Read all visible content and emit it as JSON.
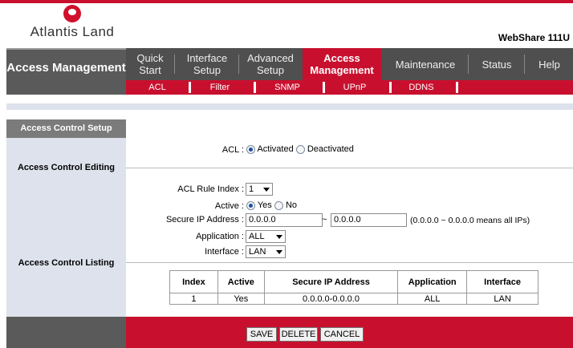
{
  "brand": {
    "logo_text": "Atlantis Land",
    "model": "WebShare 111U"
  },
  "section": {
    "title": "Access Management"
  },
  "nav": {
    "tabs": [
      {
        "label": "Quick Start"
      },
      {
        "label": "Interface Setup"
      },
      {
        "label": "Advanced Setup"
      },
      {
        "label": "Access Management"
      },
      {
        "label": "Maintenance"
      },
      {
        "label": "Status"
      },
      {
        "label": "Help"
      }
    ]
  },
  "subnav": {
    "tabs": [
      {
        "label": "ACL"
      },
      {
        "label": "Filter"
      },
      {
        "label": "SNMP"
      },
      {
        "label": "UPnP"
      },
      {
        "label": "DDNS"
      }
    ]
  },
  "left": {
    "setup_head": "Access Control Setup",
    "editing": "Access Control Editing",
    "listing": "Access Control Listing"
  },
  "form": {
    "acl_label": "ACL :",
    "acl_activated": "Activated",
    "acl_deactivated": "Deactivated",
    "rule_index_label": "ACL Rule Index :",
    "rule_index_value": "1",
    "active_label": "Active :",
    "active_yes": "Yes",
    "active_no": "No",
    "secure_ip_label": "Secure IP Address :",
    "ip_start": "0.0.0.0",
    "ip_sep": "~",
    "ip_end": "0.0.0.0",
    "ip_hint": "(0.0.0.0 ~ 0.0.0.0 means all IPs)",
    "application_label": "Application :",
    "application_value": "ALL",
    "interface_label": "Interface :",
    "interface_value": "LAN"
  },
  "table": {
    "headers": [
      "Index",
      "Active",
      "Secure IP Address",
      "Application",
      "Interface"
    ],
    "rows": [
      [
        "1",
        "Yes",
        "0.0.0.0-0.0.0.0",
        "ALL",
        "LAN"
      ]
    ]
  },
  "buttons": {
    "save": "SAVE",
    "delete": "DELETE",
    "cancel": "CANCEL"
  },
  "colors": {
    "brand_red": "#c8102e",
    "nav_gray": "#4f4f4f",
    "panel_blue": "#dde2ec"
  }
}
